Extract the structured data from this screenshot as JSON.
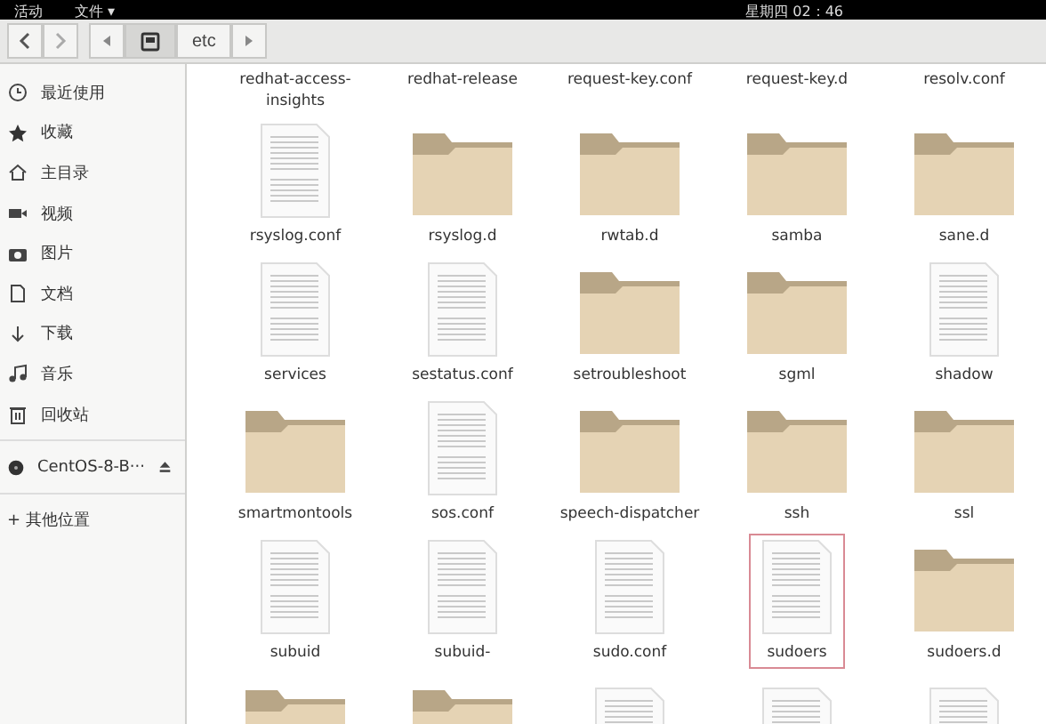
{
  "top_bar": {
    "activities": "活动",
    "app_menu": "文件 ▾",
    "clock": "星期四 02：46"
  },
  "toolbar": {
    "path": [
      {
        "kind": "drive",
        "selected": true
      },
      {
        "kind": "folder",
        "label": "etc",
        "selected": false
      }
    ]
  },
  "sidebar": {
    "places": [
      {
        "kind": "recent",
        "label": "最近使用"
      },
      {
        "kind": "star",
        "label": "收藏"
      },
      {
        "kind": "home",
        "label": "主目录"
      },
      {
        "kind": "video",
        "label": "视频"
      },
      {
        "kind": "photo",
        "label": "图片"
      },
      {
        "kind": "doc",
        "label": "文档"
      },
      {
        "kind": "download",
        "label": "下载"
      },
      {
        "kind": "music",
        "label": "音乐"
      },
      {
        "kind": "trash",
        "label": "回收站"
      }
    ],
    "devices": [
      {
        "label": "CentOS-8-B···"
      }
    ],
    "other": {
      "icon": "+",
      "label": "其他位置"
    }
  },
  "top_labels": [
    "redhat-access-insights",
    "redhat-release",
    "request-key.conf",
    "request-key.d",
    "resolv.conf"
  ],
  "files": [
    {
      "kind": "file",
      "name": "rsyslog.conf",
      "selected": false
    },
    {
      "kind": "folder",
      "name": "rsyslog.d",
      "selected": false
    },
    {
      "kind": "folder",
      "name": "rwtab.d",
      "selected": false
    },
    {
      "kind": "folder",
      "name": "samba",
      "selected": false
    },
    {
      "kind": "folder",
      "name": "sane.d",
      "selected": false
    },
    {
      "kind": "file",
      "name": "services",
      "selected": false
    },
    {
      "kind": "file",
      "name": "sestatus.conf",
      "selected": false
    },
    {
      "kind": "folder",
      "name": "setroubleshoot",
      "selected": false
    },
    {
      "kind": "folder",
      "name": "sgml",
      "selected": false
    },
    {
      "kind": "file",
      "name": "shadow",
      "selected": false
    },
    {
      "kind": "folder",
      "name": "smartmontools",
      "selected": false
    },
    {
      "kind": "file",
      "name": "sos.conf",
      "selected": false
    },
    {
      "kind": "folder",
      "name": "speech-dispatcher",
      "selected": false
    },
    {
      "kind": "folder",
      "name": "ssh",
      "selected": false
    },
    {
      "kind": "folder",
      "name": "ssl",
      "selected": false
    },
    {
      "kind": "file",
      "name": "subuid",
      "selected": false
    },
    {
      "kind": "file",
      "name": "subuid-",
      "selected": false
    },
    {
      "kind": "file",
      "name": "sudo.conf",
      "selected": false
    },
    {
      "kind": "file",
      "name": "sudoers",
      "selected": true
    },
    {
      "kind": "folder",
      "name": "sudoers.d",
      "selected": false
    }
  ],
  "cut_row": [
    {
      "kind": "folder"
    },
    {
      "kind": "folder"
    },
    {
      "kind": "file"
    },
    {
      "kind": "file"
    },
    {
      "kind": "file"
    }
  ]
}
